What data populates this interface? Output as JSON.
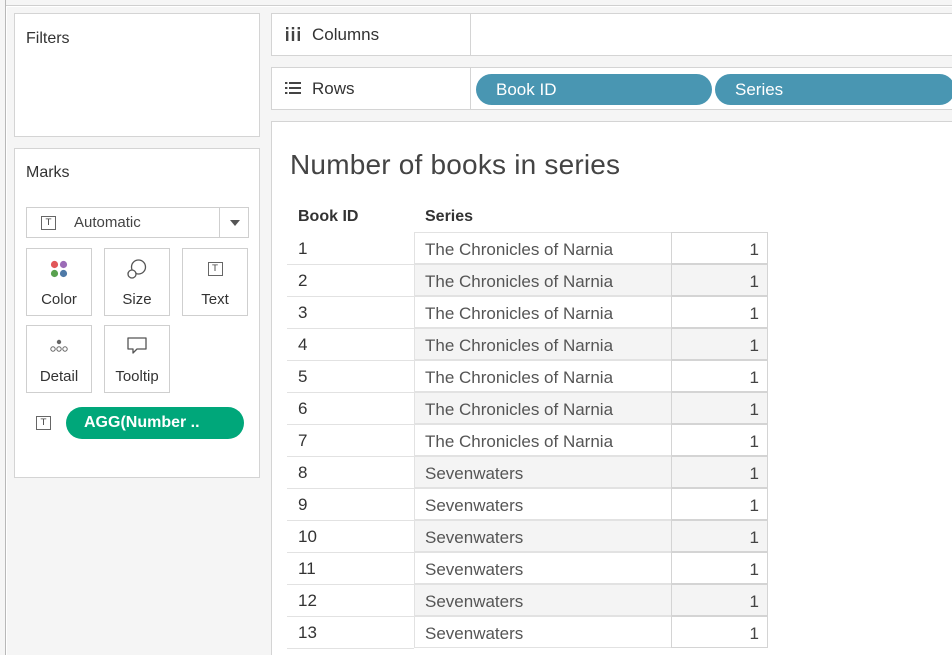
{
  "panels": {
    "filters_title": "Filters",
    "marks_title": "Marks",
    "mark_type": "Automatic",
    "mark_buttons": {
      "color": "Color",
      "size": "Size",
      "text": "Text",
      "detail": "Detail",
      "tooltip": "Tooltip"
    },
    "text_pill": "AGG(Number .."
  },
  "shelves": {
    "columns_label": "Columns",
    "rows_label": "Rows",
    "rows_pills": [
      "Book ID",
      "Series"
    ]
  },
  "colors": {
    "dimension_pill": "#4996b2",
    "measure_pill": "#00a77a"
  },
  "viz": {
    "title": "Number of books in series",
    "headers": [
      "Book ID",
      "Series"
    ],
    "rows": [
      {
        "id": "1",
        "series": "The Chronicles of Narnia",
        "value": "1"
      },
      {
        "id": "2",
        "series": "The Chronicles of Narnia",
        "value": "1"
      },
      {
        "id": "3",
        "series": "The Chronicles of Narnia",
        "value": "1"
      },
      {
        "id": "4",
        "series": "The Chronicles of Narnia",
        "value": "1"
      },
      {
        "id": "5",
        "series": "The Chronicles of Narnia",
        "value": "1"
      },
      {
        "id": "6",
        "series": "The Chronicles of Narnia",
        "value": "1"
      },
      {
        "id": "7",
        "series": "The Chronicles of Narnia",
        "value": "1"
      },
      {
        "id": "8",
        "series": "Sevenwaters",
        "value": "1"
      },
      {
        "id": "9",
        "series": "Sevenwaters",
        "value": "1"
      },
      {
        "id": "10",
        "series": "Sevenwaters",
        "value": "1"
      },
      {
        "id": "11",
        "series": "Sevenwaters",
        "value": "1"
      },
      {
        "id": "12",
        "series": "Sevenwaters",
        "value": "1"
      },
      {
        "id": "13",
        "series": "Sevenwaters",
        "value": "1"
      }
    ]
  }
}
